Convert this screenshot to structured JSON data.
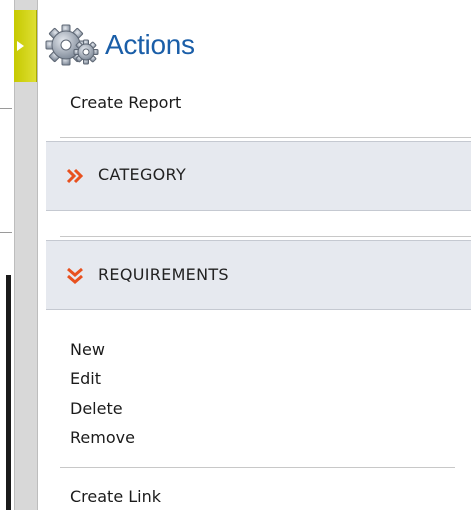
{
  "panel": {
    "title": "Actions",
    "top_link": "Create Report"
  },
  "sections": {
    "category": {
      "label": "CATEGORY",
      "state": "collapsed"
    },
    "requirements": {
      "label": "REQUIREMENTS",
      "state": "expanded"
    }
  },
  "requirements_actions": [
    "New",
    "Edit",
    "Delete",
    "Remove"
  ],
  "bottom_link": "Create Link",
  "icons": {
    "panel_icon": "gear-icon",
    "collapsed_chevron": "chevron-double-right-icon",
    "expanded_chevron": "chevron-double-down-icon",
    "collapse_arrow": "arrow-right-icon"
  },
  "colors": {
    "title": "#1a5ea8",
    "chevron": "#e8511f",
    "handle": "#c6c900",
    "section_bg": "#e6e9ef"
  }
}
